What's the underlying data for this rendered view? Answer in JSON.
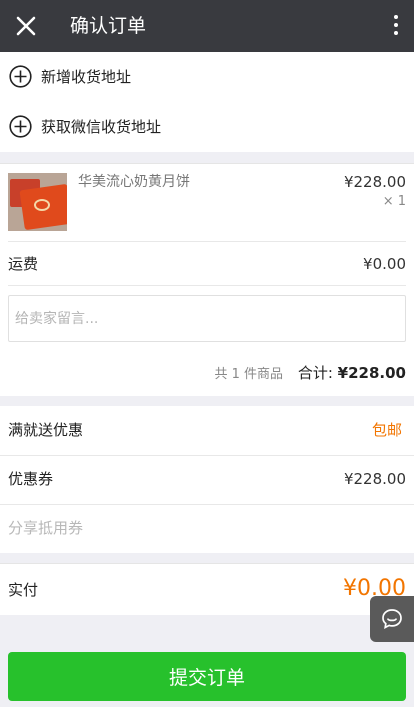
{
  "header": {
    "title": "确认订单",
    "close_icon": "close-icon",
    "more_icon": "more-vertical-icon"
  },
  "address": {
    "add_label": "新增收货地址",
    "wechat_label": "获取微信收货地址",
    "icon": "plus-circle-icon"
  },
  "order": {
    "product_name": "华美流心奶黄月饼",
    "product_price": "¥228.00",
    "product_qty": "× 1",
    "shipping_label": "运费",
    "shipping_value": "¥0.00",
    "message_placeholder": "给卖家留言...",
    "count_text": "共 1 件商品",
    "total_label": "合计: ",
    "total_value": "¥228.00"
  },
  "promotions": {
    "full_gift_label": "满就送优惠",
    "full_gift_value": "包邮",
    "coupon_label": "优惠券",
    "coupon_value": "¥228.00",
    "share_coupon_label": "分享抵用券"
  },
  "payment": {
    "label": "实付",
    "amount": "¥0.00"
  },
  "submit_label": "提交订单",
  "colors": {
    "header_bg": "#393a3f",
    "accent_orange": "#f27500",
    "submit_green": "#27c12c"
  }
}
